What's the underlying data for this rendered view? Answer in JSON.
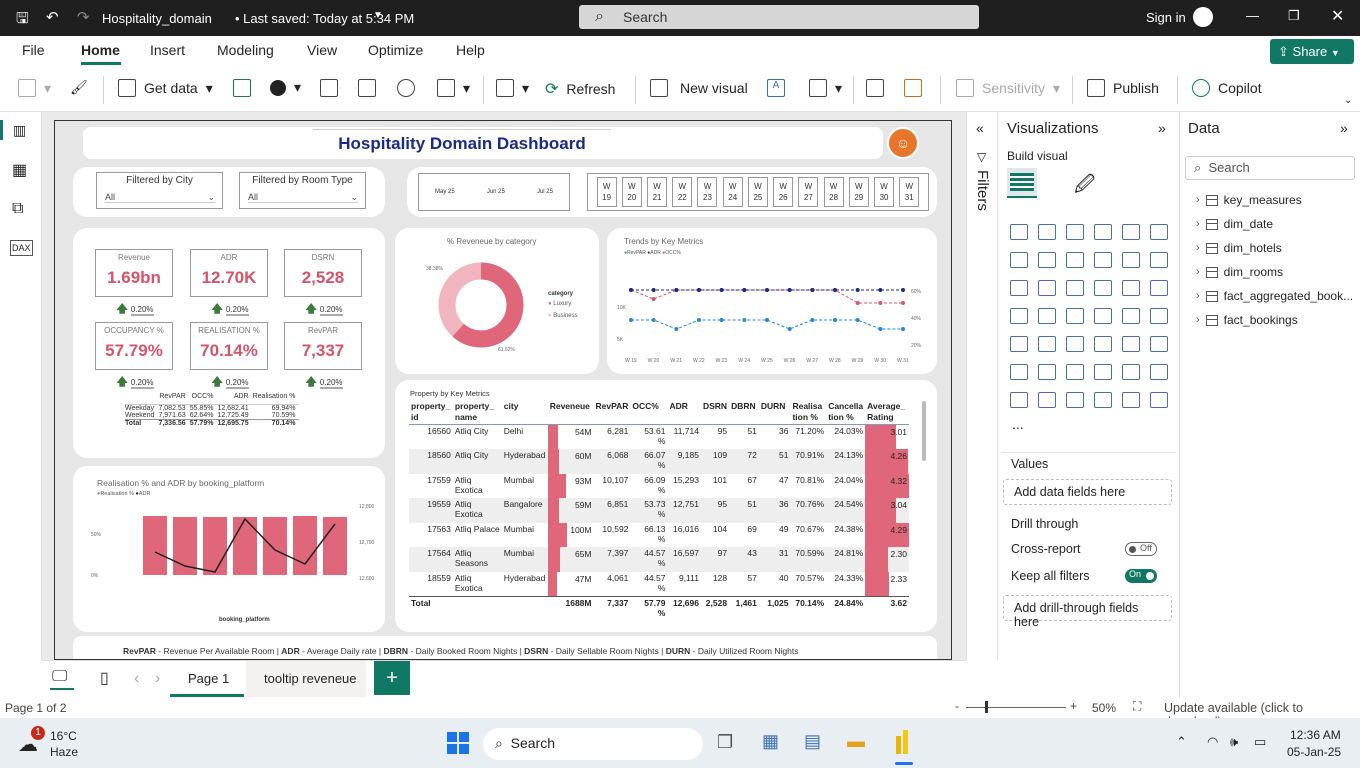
{
  "titlebar": {
    "file_title": "Hospitality_domain",
    "saved": "• Last saved: Today at 5:34 PM",
    "search_placeholder": "Search",
    "sign_in": "Sign in"
  },
  "menu": {
    "file": "File",
    "home": "Home",
    "insert": "Insert",
    "modeling": "Modeling",
    "view": "View",
    "optimize": "Optimize",
    "help": "Help",
    "share": "Share"
  },
  "ribbon": {
    "get_data": "Get data",
    "refresh": "Refresh",
    "new_visual": "New visual",
    "sensitivity": "Sensitivity",
    "publish": "Publish",
    "copilot": "Copilot"
  },
  "report": {
    "title": "Hospitality Domain Dashboard",
    "slicers": {
      "city_label": "Filtered by City",
      "city_value": "All",
      "room_label": "Filtered by Room Type",
      "room_value": "All",
      "months": [
        "May 25",
        "Jun 25",
        "Jul 25"
      ],
      "weeks": [
        "W\n19",
        "W\n20",
        "W\n21",
        "W\n22",
        "W\n23",
        "W\n24",
        "W\n25",
        "W\n26",
        "W\n27",
        "W\n28",
        "W\n29",
        "W\n30",
        "W\n31"
      ]
    },
    "kpis": [
      {
        "label": "Revenue",
        "value": "1.69bn",
        "delta": "0.20%"
      },
      {
        "label": "ADR",
        "value": "12.70K",
        "delta": "0.20%"
      },
      {
        "label": "DSRN",
        "value": "2,528",
        "delta": "0.20%"
      },
      {
        "label": "OCCUPANCY %",
        "value": "57.79%",
        "delta": "0.20%"
      },
      {
        "label": "REALISATION %",
        "value": "70.14%",
        "delta": "0.20%"
      },
      {
        "label": "RevPAR",
        "value": "7,337",
        "delta": "0.20%"
      }
    ],
    "mini_table": {
      "headers": [
        "",
        "RevPAR",
        "OCC%",
        "ADR",
        "Realisation %"
      ],
      "rows": [
        [
          "Weekday",
          "7,082.53",
          "55.85%",
          "12,682.41",
          "69.94%"
        ],
        [
          "Weekend",
          "7,971.63",
          "62.64%",
          "12,725.49",
          "70.59%"
        ],
        [
          "Total",
          "7,336.56",
          "57.79%",
          "12,695.75",
          "70.14%"
        ]
      ]
    },
    "donut": {
      "title": "% Reveneue by category",
      "legend_title": "category",
      "labels": [
        "Luxury",
        "Business"
      ],
      "pct_luxury": "61.62%",
      "pct_business": "38.38%",
      "colors": [
        "#e0677a",
        "#f1b5bf"
      ]
    },
    "trend": {
      "title": "Trends by Key Metrics",
      "legend": [
        "RevPAR",
        "ADR",
        "OCC%"
      ],
      "y_left": [
        "10K",
        "5K"
      ],
      "y_right": [
        "60%",
        "40%",
        "20%"
      ],
      "x": [
        "W 19",
        "W 20",
        "W 21",
        "W 22",
        "W 23",
        "W 24",
        "W 25",
        "W 26",
        "W 27",
        "W 28",
        "W 29",
        "W 30",
        "W 31"
      ]
    },
    "platform": {
      "title": "Realisation % and ADR by booking_platform",
      "legend": [
        "Realisation %",
        "ADR"
      ],
      "xlabel": "booking_platform",
      "y_left": [
        "50%",
        "0%"
      ],
      "y_right": [
        "12,800",
        "12,700",
        "12,600"
      ]
    },
    "property_table": {
      "title": "Property by Key Metrics",
      "headers": [
        "property_\nid",
        "property_\nname",
        "city",
        "Reveneue",
        "RevPAR",
        "OCC%",
        "ADR",
        "DSRN",
        "DBRN",
        "DURN",
        "Realisa\ntion %",
        "Cancella\ntion %",
        "Average_\nRating"
      ],
      "rows": [
        [
          "16560",
          "Atliq City",
          "Delhi",
          "54M",
          "6,281",
          "53.61\n%",
          "11,714",
          "95",
          "51",
          "36",
          "71.20%",
          "24.03%",
          "3.01"
        ],
        [
          "18560",
          "Atliq City",
          "Hyderabad",
          "60M",
          "6,068",
          "66.07\n%",
          "9,185",
          "109",
          "72",
          "51",
          "70.91%",
          "24.13%",
          "4.26"
        ],
        [
          "17559",
          "Atliq\nExotica",
          "Mumbai",
          "93M",
          "10,107",
          "66.09\n%",
          "15,293",
          "101",
          "67",
          "47",
          "70.81%",
          "24.04%",
          "4.32"
        ],
        [
          "19559",
          "Atliq\nExotica",
          "Bangalore",
          "59M",
          "6,851",
          "53.73\n%",
          "12,751",
          "95",
          "51",
          "36",
          "70.76%",
          "24.54%",
          "3.04"
        ],
        [
          "17563",
          "Atliq Palace",
          "Mumbai",
          "100M",
          "10,592",
          "66.13\n%",
          "16,016",
          "104",
          "69",
          "49",
          "70.67%",
          "24.38%",
          "4.29"
        ],
        [
          "17564",
          "Atliq\nSeasons",
          "Mumbai",
          "65M",
          "7,397",
          "44.57\n%",
          "16,597",
          "97",
          "43",
          "31",
          "70.59%",
          "24.81%",
          "2.30"
        ],
        [
          "18559",
          "Atliq\nExotica",
          "Hyderabad",
          "47M",
          "4,061",
          "44.57\n%",
          "9,111",
          "128",
          "57",
          "40",
          "70.57%",
          "24.33%",
          "2.33"
        ]
      ],
      "total": [
        "Total",
        "",
        "",
        "1688M",
        "7,337",
        "57.79\n%",
        "12,696",
        "2,528",
        "1,461",
        "1,025",
        "70.14%",
        "24.84%",
        "3.62"
      ]
    },
    "footnote_parts": [
      {
        "b": "RevPAR",
        "t": " - Revenue Per Available Room | "
      },
      {
        "b": "ADR",
        "t": " - Average Daily rate | "
      },
      {
        "b": "DBRN",
        "t": " - Daily Booked Room Nights | "
      },
      {
        "b": "DSRN",
        "t": " - Daily Sellable Room Nights | "
      },
      {
        "b": "DURN",
        "t": " - Daily Utilized Room Nights"
      }
    ]
  },
  "filters_label": "Filters",
  "viz": {
    "title": "Visualizations",
    "build": "Build visual",
    "values": "Values",
    "add_data": "Add data fields here",
    "drill": "Drill through",
    "cross": "Cross-report",
    "cross_state": "Off",
    "keep": "Keep all filters",
    "keep_state": "On",
    "add_drill": "Add drill-through fields here",
    "more": "..."
  },
  "data": {
    "title": "Data",
    "search": "Search",
    "items": [
      "key_measures",
      "dim_date",
      "dim_hotels",
      "dim_rooms",
      "fact_aggregated_book...",
      "fact_bookings"
    ]
  },
  "pages": {
    "page1": "Page 1",
    "page2": "tooltip reveneue"
  },
  "status": {
    "page": "Page 1 of 2",
    "zoom": "50%",
    "update": "Update available (click to download)"
  },
  "taskbar": {
    "temp": "16°C",
    "weather": "Haze",
    "search": "Search",
    "time": "12:36 AM",
    "date": "05-Jan-25",
    "badge": "1"
  }
}
